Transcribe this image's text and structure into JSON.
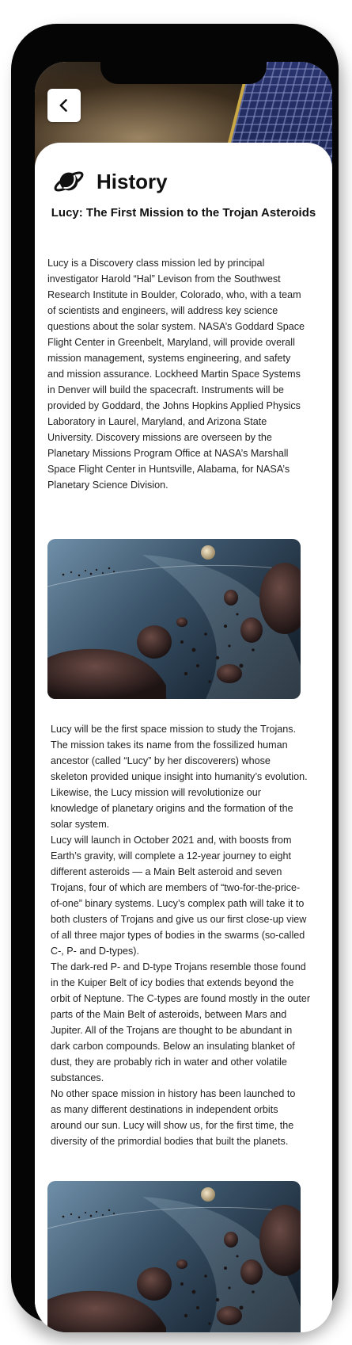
{
  "page": {
    "title": "History",
    "subtitle": "Lucy: The First Mission to the Trojan Asteroids"
  },
  "icons": {
    "back": "chevron-left-icon",
    "title": "planet-icon"
  },
  "paragraphs": [
    "Lucy is a Discovery class mission led by principal investigator Harold “Hal” Levison from the Southwest Research Institute in Boulder, Colorado, who, with a team of scientists and engineers, will address key science questions about the solar system. NASA’s Goddard Space Flight Center in Greenbelt, Maryland, will provide overall mission management, systems engineering, and safety and mission assurance. Lockheed Martin Space Systems in Denver will build the spacecraft. Instruments will be provided by Goddard, the Johns Hopkins Applied Physics Laboratory in Laurel, Maryland, and Arizona State University. Discovery missions are overseen by the Planetary Missions Program Office at NASA’s Marshall Space Flight Center in Huntsville, Alabama, for NASA’s Planetary Science Division.",
    "Lucy will be the first space mission to study the Trojans. The mission takes its name from the fossilized human ancestor (called “Lucy” by her discoverers) whose skeleton provided unique insight into humanity’s evolution. Likewise, the Lucy mission will revolutionize our knowledge of planetary origins and the formation of the solar system.",
    "Lucy will launch in October 2021 and, with boosts from Earth’s gravity, will complete a 12-year journey to eight different asteroids — a Main Belt asteroid and seven Trojans, four of which are members of “two-for-the-price-of-one” binary systems. Lucy’s complex path will take it to both clusters of Trojans and give us our first close-up view of all three major types of bodies in the swarms (so-called C-, P- and D-types).",
    "The dark-red P- and D-type Trojans resemble those found in the Kuiper Belt of icy bodies that extends beyond the orbit of Neptune. The C-types are found mostly in the outer parts of the Main Belt of asteroids, between Mars and Jupiter. All of the Trojans are thought to be abundant in dark carbon compounds. Below an insulating blanket of dust, they are probably rich in water and other volatile substances.",
    "No other space mission in history has been launched to as many different destinations in independent orbits around our sun. Lucy will show us, for the first time, the diversity of the primordial bodies that built the planets."
  ],
  "colors": {
    "frame": "#050505",
    "card": "#ffffff",
    "text": "#222222"
  }
}
